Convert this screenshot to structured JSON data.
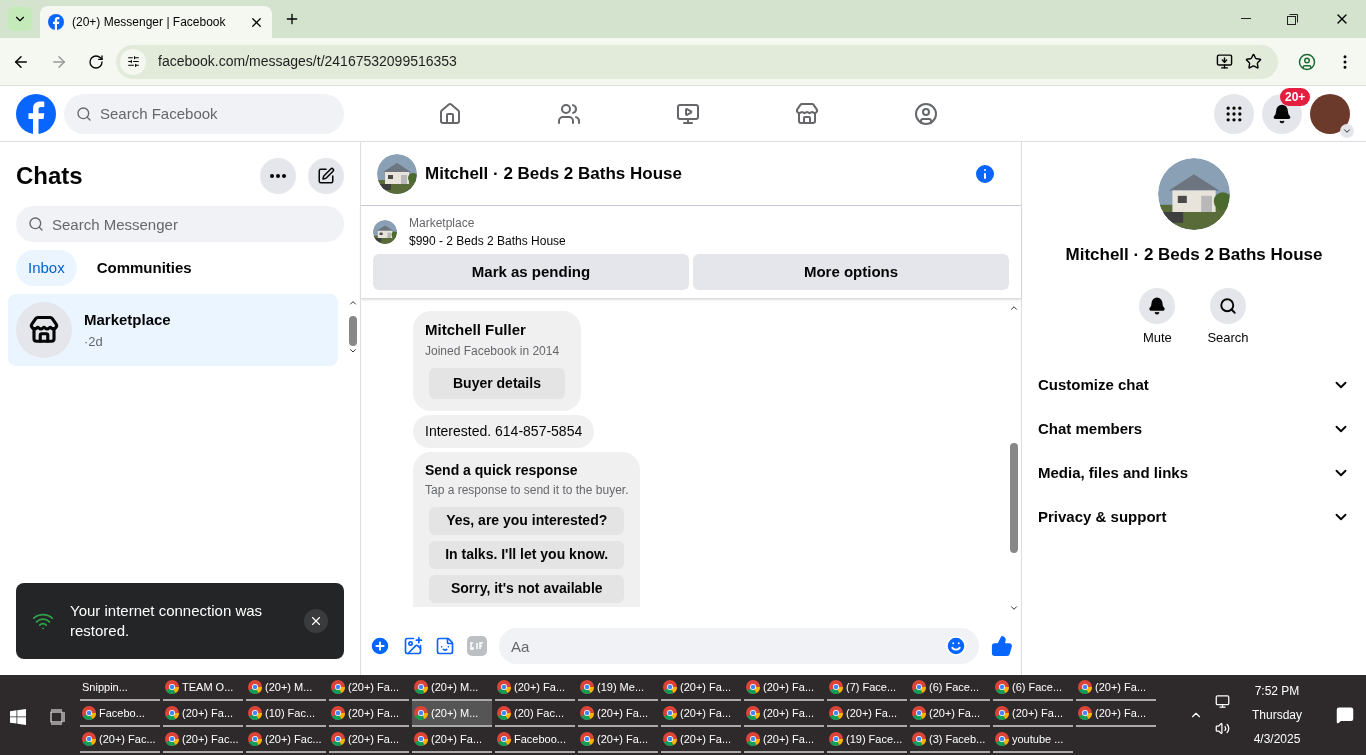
{
  "browser": {
    "tab_title": "(20+) Messenger | Facebook",
    "url": "facebook.com/messages/t/24167532099516353"
  },
  "facebook_bar": {
    "search_placeholder": "Search Facebook",
    "nav": [
      {
        "kind": "home",
        "selected": false
      },
      {
        "kind": "friends",
        "selected": false
      },
      {
        "kind": "video",
        "selected": false
      },
      {
        "kind": "marketplace",
        "selected": false
      },
      {
        "kind": "groups",
        "selected": false
      }
    ],
    "notification_badge": "20+"
  },
  "chats": {
    "title": "Chats",
    "search_placeholder": "Search Messenger",
    "filters": [
      {
        "label": "Inbox",
        "selected": true
      },
      {
        "label": "Communities",
        "selected": false
      }
    ],
    "items": [
      {
        "name": "Marketplace",
        "time": "·2d",
        "selected": true
      }
    ]
  },
  "toast": {
    "text": "Your internet connection was restored."
  },
  "conversation": {
    "title": "Mitchell · 2 Beds 2 Baths House",
    "listing_source": "Marketplace",
    "listing": "$990 - 2 Beds 2 Baths House",
    "actions": [
      "Mark as pending",
      "More options"
    ],
    "buyer": {
      "name": "Mitchell Fuller",
      "joined": "Joined Facebook in 2014",
      "button": "Buyer details"
    },
    "message": "Interested. 614-857-5854",
    "quick": {
      "title": "Send a quick response",
      "hint": "Tap a response to send it to the buyer.",
      "responses": [
        "Yes, are you interested?",
        "In talks. I'll let you know.",
        "Sorry, it's not available"
      ]
    },
    "composer_placeholder": "Aa"
  },
  "details": {
    "title": "Mitchell · 2 Beds 2 Baths House",
    "actions": [
      {
        "kind": "mute",
        "label": "Mute"
      },
      {
        "kind": "search",
        "label": "Search"
      }
    ],
    "sections": [
      "Customize chat",
      "Chat members",
      "Media, files and links",
      "Privacy & support"
    ]
  },
  "taskbar": {
    "rows": [
      [
        {
          "label": "Snippin...",
          "selected": false
        },
        {
          "label": "TEAM O...",
          "selected": false
        },
        {
          "label": "(20+) M...",
          "selected": false
        },
        {
          "label": "(20+) Fa...",
          "selected": false
        },
        {
          "label": "(20+) M...",
          "selected": false
        },
        {
          "label": "(20+) Fa...",
          "selected": false
        },
        {
          "label": "(19) Me...",
          "selected": false
        },
        {
          "label": "(20+) Fa...",
          "selected": false
        },
        {
          "label": "(20+) Fa...",
          "selected": false
        },
        {
          "label": "(7) Face...",
          "selected": false
        },
        {
          "label": "(6) Face...",
          "selected": false
        },
        {
          "label": "(6) Face...",
          "selected": false
        },
        {
          "label": "(20+) Fa...",
          "selected": false
        }
      ],
      [
        {
          "label": "Facebo...",
          "selected": false
        },
        {
          "label": "(20+) Fa...",
          "selected": false
        },
        {
          "label": "(10) Fac...",
          "selected": false
        },
        {
          "label": "(20+) Fa...",
          "selected": false
        },
        {
          "label": "(20+) M...",
          "selected": true
        },
        {
          "label": "(20) Fac...",
          "selected": false
        },
        {
          "label": "(20+) Fa...",
          "selected": false
        },
        {
          "label": "(20+) Fa...",
          "selected": false
        },
        {
          "label": "(20+) Fa...",
          "selected": false
        },
        {
          "label": "(20+) Fa...",
          "selected": false
        },
        {
          "label": "(20+) Fa...",
          "selected": false
        },
        {
          "label": "(20+) Fa...",
          "selected": false
        },
        {
          "label": "(20+) Fa...",
          "selected": false
        }
      ],
      [
        {
          "label": "(20+) Fac...",
          "selected": false
        },
        {
          "label": "(20+) Fac...",
          "selected": false
        },
        {
          "label": "(20+) Fac...",
          "selected": false
        },
        {
          "label": "(20+) Fa...",
          "selected": false
        },
        {
          "label": "(20+) Fa...",
          "selected": false
        },
        {
          "label": "Faceboo...",
          "selected": false
        },
        {
          "label": "(20+) Fa...",
          "selected": false
        },
        {
          "label": "(20+) Fa...",
          "selected": false
        },
        {
          "label": "(20+) Fa...",
          "selected": false
        },
        {
          "label": "(19) Face...",
          "selected": false
        },
        {
          "label": "(3) Faceb...",
          "selected": false
        },
        {
          "label": "youtube ...",
          "selected": false
        }
      ]
    ],
    "time": "7:52 PM",
    "day": "Thursday",
    "date": "4/3/2025"
  }
}
